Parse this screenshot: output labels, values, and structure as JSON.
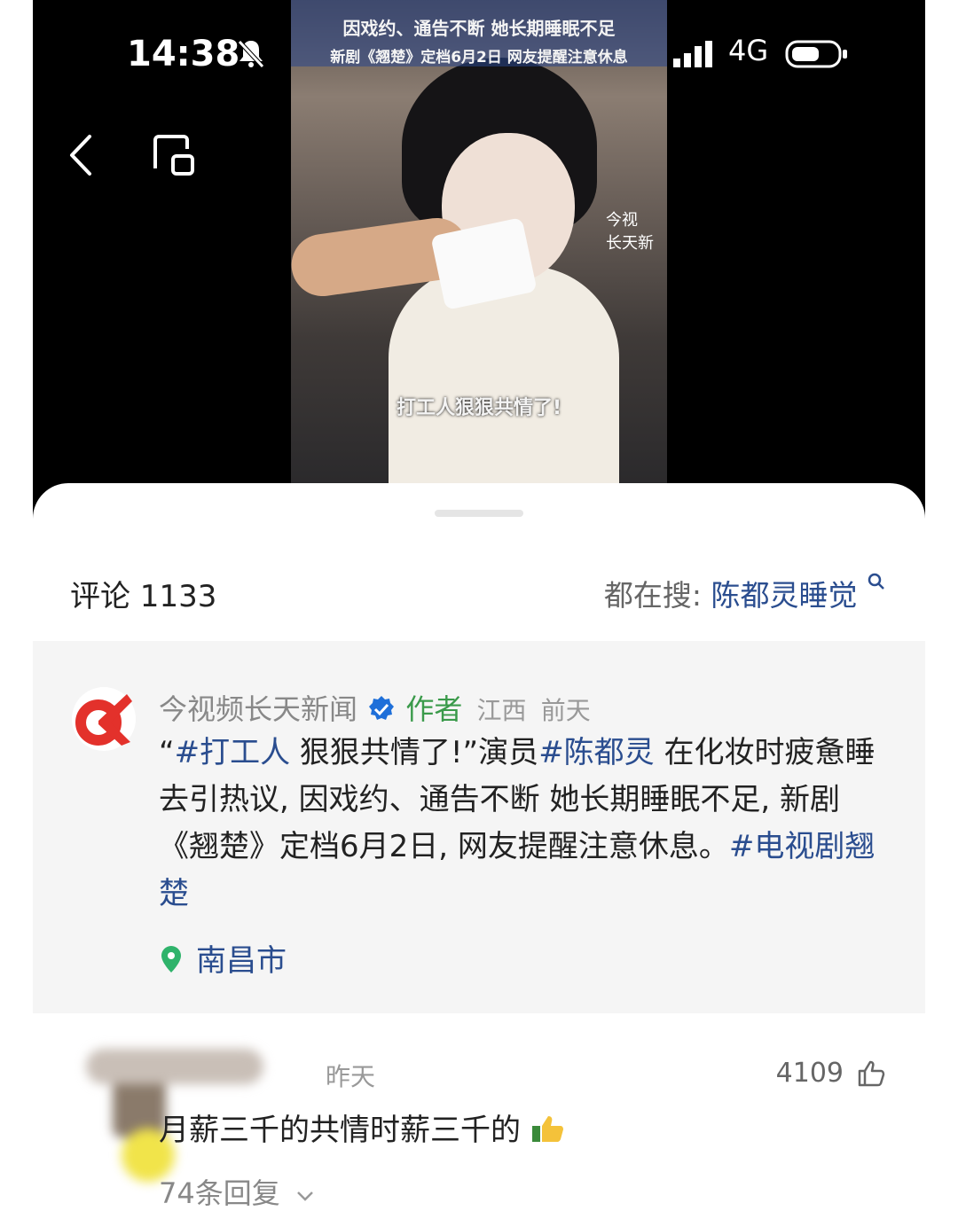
{
  "status_bar": {
    "time": "14:38",
    "network": "4G"
  },
  "video": {
    "caption_line1": "因戏约、通告不断 她长期睡眠不足",
    "caption_line2": "新剧《翘楚》定档6月2日 网友提醒注意休息",
    "subtitle": "打工人狠狠共情了!",
    "watermark_line1": "今视",
    "watermark_line2": "长天新"
  },
  "sheet": {
    "comments_label": "评论 1133",
    "hot_search_prefix": "都在搜:",
    "hot_search_keyword": "陈都灵睡觉"
  },
  "author_post": {
    "author_name": "今视频长天新闻",
    "author_badge": "作者",
    "region": "江西",
    "time": "前天",
    "text_parts": {
      "p1": "“",
      "tag1": "#打工人",
      "p2": " 狠狠共情了!”演员",
      "tag2": "#陈都灵",
      "p3": " 在化妆时疲惫睡去引热议, 因戏约、通告不断 她长期睡眠不足, 新剧《翘楚》定档6月2日, 网友提醒注意休息。",
      "tag3": "#电视剧翘楚"
    },
    "location": "南昌市"
  },
  "comment": {
    "time": "昨天",
    "likes": "4109",
    "text": "月薪三千的共情时薪三千的",
    "replies": "74条回复"
  },
  "colors": {
    "link": "#2a4d8f",
    "verified": "#1e6fd9",
    "author_badge": "#3a9a4a",
    "logo_red": "#e3312b",
    "location_green": "#2fb36b"
  }
}
